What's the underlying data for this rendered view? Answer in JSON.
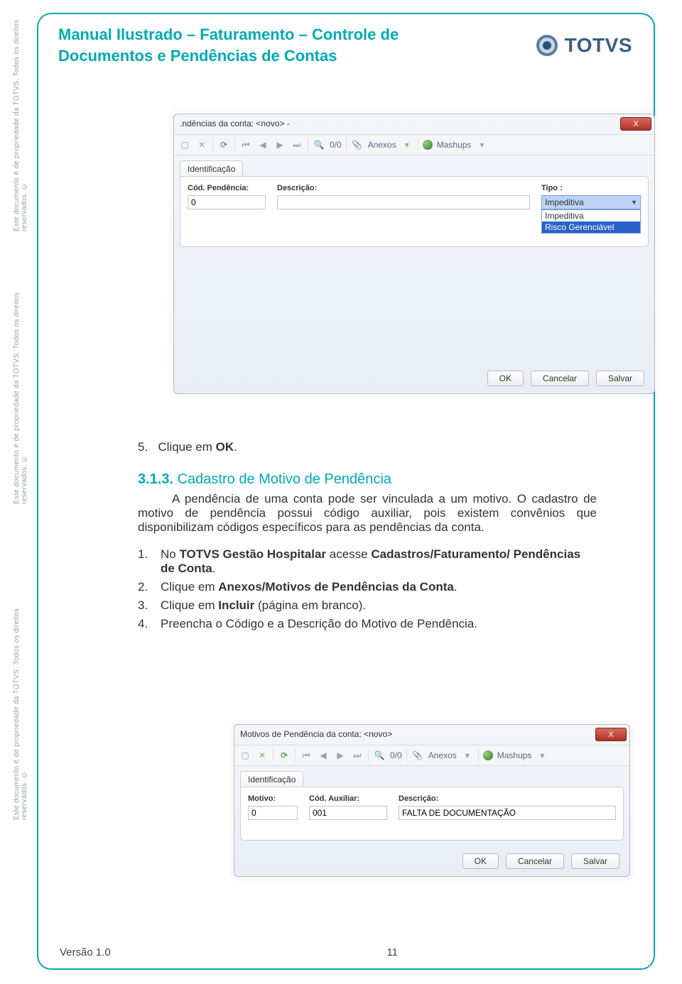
{
  "header": {
    "title": "Manual Ilustrado – Faturamento – Controle de Documentos e Pendências de Contas",
    "brand": "TOTVS"
  },
  "side_note": "Este documento é de propriedade da TOTVS. Todos os direitos reservados. ©",
  "screenshot1": {
    "window_title": ".ndências da conta: <novo> -",
    "close_x": "X",
    "toolbar": {
      "counter": "0/0",
      "anexos": "Anexos",
      "mashups": "Mashups"
    },
    "tab": "Identificação",
    "labels": {
      "cod": "Cód. Pendência:",
      "desc": "Descrição:",
      "tipo": "Tipo :"
    },
    "values": {
      "cod": "0",
      "desc": "",
      "tipo_selected": "Impeditiva",
      "tipo_options": [
        "Impeditiva",
        "Risco Gerenciável"
      ]
    },
    "buttons": {
      "ok": "OK",
      "cancelar": "Cancelar",
      "salvar": "Salvar"
    }
  },
  "body": {
    "step5_num": "5.",
    "step5_text": "Clique em ",
    "step5_bold": "OK",
    "step5_end": ".",
    "section_num": "3.1.3.",
    "section_title": "Cadastro de Motivo de Pendência",
    "para": "A pendência de uma conta pode ser vinculada a um motivo. O cadastro de motivo de pendência possui código auxiliar, pois existem convênios que disponibilizam códigos específicos para as pendências da conta.",
    "list": [
      {
        "n": "1.",
        "pre": "No ",
        "b1": "TOTVS Gestão Hospitalar",
        "mid": " acesse ",
        "b2": "Cadastros/Faturamento/ Pendências de Conta",
        "end": "."
      },
      {
        "n": "2.",
        "pre": "Clique em ",
        "b1": "Anexos/Motivos de Pendências da Conta",
        "mid": "",
        "b2": "",
        "end": "."
      },
      {
        "n": "3.",
        "pre": "Clique em ",
        "b1": "Incluir",
        "mid": " (página em branco).",
        "b2": "",
        "end": ""
      },
      {
        "n": "4.",
        "pre": "Preencha o Código e a Descrição do Motivo de Pendência.",
        "b1": "",
        "mid": "",
        "b2": "",
        "end": ""
      }
    ]
  },
  "screenshot2": {
    "window_title": "Motivos de Pendência da conta: <novo>",
    "close_x": "X",
    "toolbar": {
      "counter": "0/0",
      "anexos": "Anexos",
      "mashups": "Mashups"
    },
    "tab": "Identificação",
    "labels": {
      "motivo": "Motivo:",
      "codaux": "Cód. Auxiliar:",
      "desc": "Descrição:"
    },
    "values": {
      "motivo": "0",
      "codaux": "001",
      "desc": "FALTA DE DOCUMENTAÇÃO"
    },
    "buttons": {
      "ok": "OK",
      "cancelar": "Cancelar",
      "salvar": "Salvar"
    }
  },
  "footer": {
    "version": "Versão 1.0",
    "page": "11"
  }
}
